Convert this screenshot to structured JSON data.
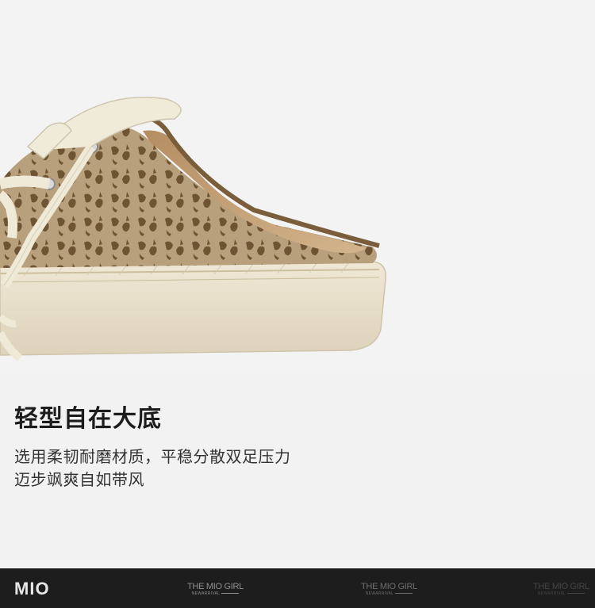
{
  "product_image": {
    "alt": "shoe-photo"
  },
  "headline": "轻型自在大底",
  "description": {
    "line1": "选用柔韧耐磨材质，平稳分散双足压力",
    "line2": "迈步飒爽自如带风"
  },
  "footer": {
    "logo": "MIO",
    "tags": [
      {
        "title": "THE MIO GIRL",
        "sub": "NEWARRIVAL"
      },
      {
        "title": "THE MIO GIRL",
        "sub": "NEWARRIVAL"
      },
      {
        "title": "THE MIO GIRL",
        "sub": "NEWARRIVAL"
      }
    ]
  },
  "colors": {
    "background": "#f3f3f3",
    "footer_bg": "#1d1d1d",
    "canvas_tan": "#b59a76",
    "pattern_brown": "#6e5433",
    "sole_cream": "#e8dfcb"
  }
}
